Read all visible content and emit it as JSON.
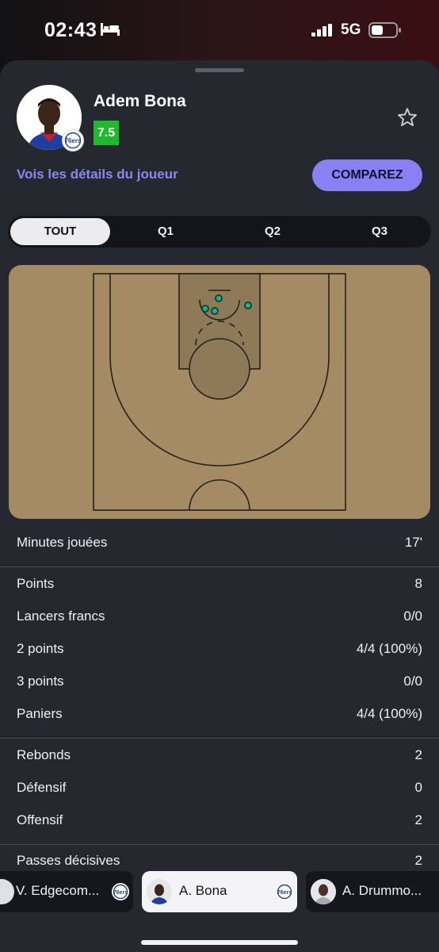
{
  "status_bar": {
    "time": "02:43",
    "network": "5G"
  },
  "player": {
    "name": "Adem Bona",
    "rating": "7.5",
    "team_logo_text": "76ers"
  },
  "links": {
    "details": "Vois les détails du joueur",
    "compare": "COMPAREZ"
  },
  "tabs": [
    {
      "label": "TOUT",
      "active": true
    },
    {
      "label": "Q1",
      "active": false
    },
    {
      "label": "Q2",
      "active": false
    },
    {
      "label": "Q3",
      "active": false
    }
  ],
  "colors": {
    "court": "#a58b63",
    "shot_made": "#1db18e",
    "rating_bg": "#1dbb2c",
    "accent": "#8880f4",
    "sheet_bg": "#262830"
  },
  "shots": [
    {
      "result": "made"
    },
    {
      "result": "made"
    },
    {
      "result": "made"
    },
    {
      "result": "made"
    }
  ],
  "stats": {
    "minutes": {
      "label": "Minutes jouées",
      "value": "17'"
    },
    "points": {
      "label": "Points",
      "value": "8"
    },
    "free_throws": {
      "label": "Lancers francs",
      "value": "0/0"
    },
    "two_points": {
      "label": "2 points",
      "value": "4/4 (100%)"
    },
    "three_points": {
      "label": "3 points",
      "value": "0/0"
    },
    "field_goals": {
      "label": "Paniers",
      "value": "4/4 (100%)"
    },
    "rebounds": {
      "label": "Rebonds",
      "value": "2"
    },
    "defensive": {
      "label": "Défensif",
      "value": "0"
    },
    "offensive": {
      "label": "Offensif",
      "value": "2"
    },
    "assists": {
      "label": "Passes décisives",
      "value": "2"
    }
  },
  "carousel": [
    {
      "name": "V. Edgecom...",
      "active": false
    },
    {
      "name": "A. Bona",
      "active": true
    },
    {
      "name": "A. Drummo...",
      "active": false
    }
  ]
}
